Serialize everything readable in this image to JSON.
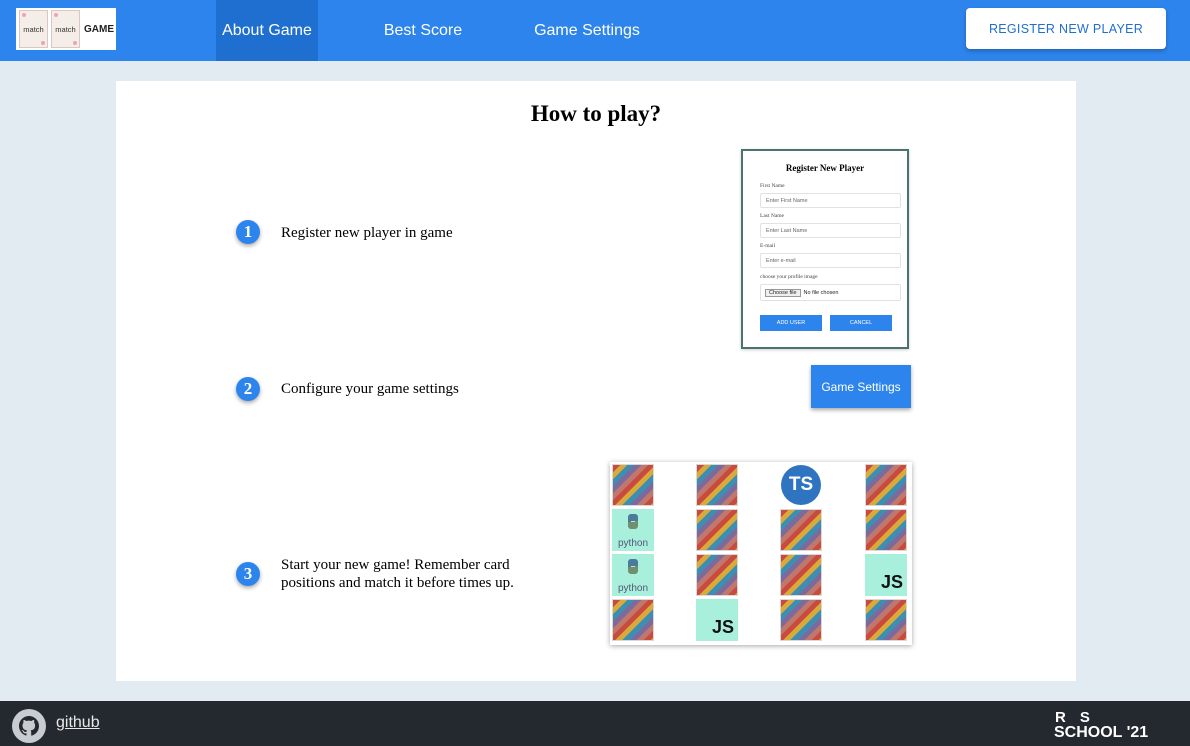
{
  "header": {
    "logo": {
      "card1": "match",
      "card2": "match",
      "text": "GAME"
    },
    "nav": [
      {
        "label": "About Game",
        "active": true
      },
      {
        "label": "Best Score",
        "active": false
      },
      {
        "label": "Game Settings",
        "active": false
      }
    ],
    "register_button": "REGISTER NEW PLAYER"
  },
  "main": {
    "title": "How to play?",
    "steps": [
      {
        "number": "1",
        "text": "Register new player in game"
      },
      {
        "number": "2",
        "text": "Configure your game settings"
      },
      {
        "number": "3",
        "text_line1": "Start your new game! Remember card",
        "text_line2": "positions and match it before times up."
      }
    ],
    "register_form": {
      "title": "Register New Player",
      "first_name_label": "First Name",
      "first_name_placeholder": "Enter First Name",
      "last_name_label": "Last Name",
      "last_name_placeholder": "Enter Last Name",
      "email_label": "E-mail",
      "email_placeholder": "Enter e-mail",
      "image_label": "choose your profile image",
      "file_button": "Choose file",
      "file_status": "No file chosen",
      "add_button": "ADD USER",
      "cancel_button": "CANCEL"
    },
    "game_settings_button": "Game Settings",
    "card_labels": {
      "ts": "TS",
      "js": "JS",
      "python": "python"
    }
  },
  "footer": {
    "github_link": "github",
    "rs_line1": "RS",
    "rs_line2": "SCHOOL '21"
  },
  "colors": {
    "primary": "#2d84ec",
    "nav_active": "#1f6fd0",
    "footer": "#24292f",
    "page_bg": "#e2eaf2"
  },
  "icons": [
    "github-icon",
    "python-logo-icon"
  ]
}
